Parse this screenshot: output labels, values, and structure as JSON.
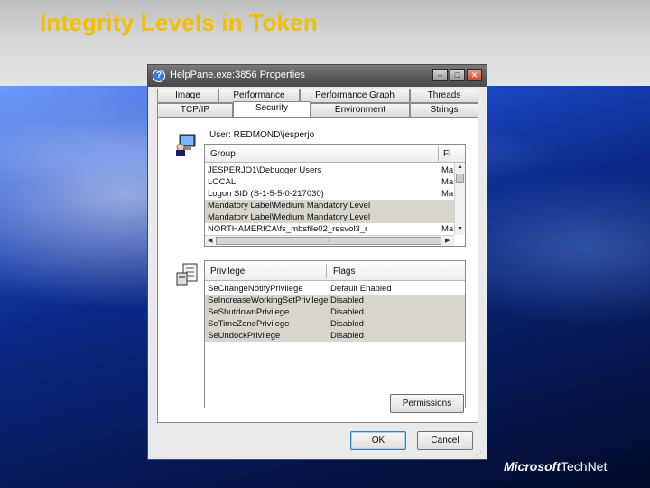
{
  "slide": {
    "title": "Integrity Levels in Token",
    "brand_bold": "Microsoft",
    "brand_regular": "TechNet"
  },
  "window": {
    "title": "HelpPane.exe:3856 Properties",
    "controls": {
      "minimize": "–",
      "maximize": "□",
      "close": "✕"
    },
    "title_icon": "?"
  },
  "tabs": {
    "row1": [
      "Image",
      "Performance",
      "Performance Graph",
      "Threads"
    ],
    "row2": [
      "TCP/IP",
      "Security",
      "Environment",
      "Strings"
    ],
    "active": "Security"
  },
  "security": {
    "user_label": "User:  REDMOND\\jesperjo",
    "group_columns": {
      "group": "Group",
      "flags": "Fl"
    },
    "groups": [
      {
        "group": "JESPERJO1\\Debugger Users",
        "flags": "Ma"
      },
      {
        "group": "LOCAL",
        "flags": "Ma"
      },
      {
        "group": "Logon SID (S-1-5-5-0-217030)",
        "flags": "Ma"
      },
      {
        "group": "Mandatory Label\\Medium Mandatory Level",
        "flags": ""
      },
      {
        "group": "Mandatory Label\\Medium Mandatory Level",
        "flags": ""
      },
      {
        "group": "NORTHAMERICA\\fs_mbsfile02_resvol3_r",
        "flags": "Ma"
      }
    ],
    "privilege_columns": {
      "privilege": "Privilege",
      "flags": "Flags"
    },
    "privileges": [
      {
        "privilege": "SeChangeNotifyPrivilege",
        "flags": "Default Enabled"
      },
      {
        "privilege": "SeIncreaseWorkingSetPrivilege",
        "flags": "Disabled"
      },
      {
        "privilege": "SeShutdownPrivilege",
        "flags": "Disabled"
      },
      {
        "privilege": "SeTimeZonePrivilege",
        "flags": "Disabled"
      },
      {
        "privilege": "SeUndockPrivilege",
        "flags": "Disabled"
      }
    ],
    "permissions_button": "Permissions"
  },
  "buttons": {
    "ok": "OK",
    "cancel": "Cancel"
  },
  "icons": {
    "users": "users-computer-icon",
    "privileges": "privileges-document-icon"
  },
  "colors": {
    "title": "#f0c000",
    "selected_row": "#d8d5cc",
    "titlebar": "#5a5a5a"
  }
}
